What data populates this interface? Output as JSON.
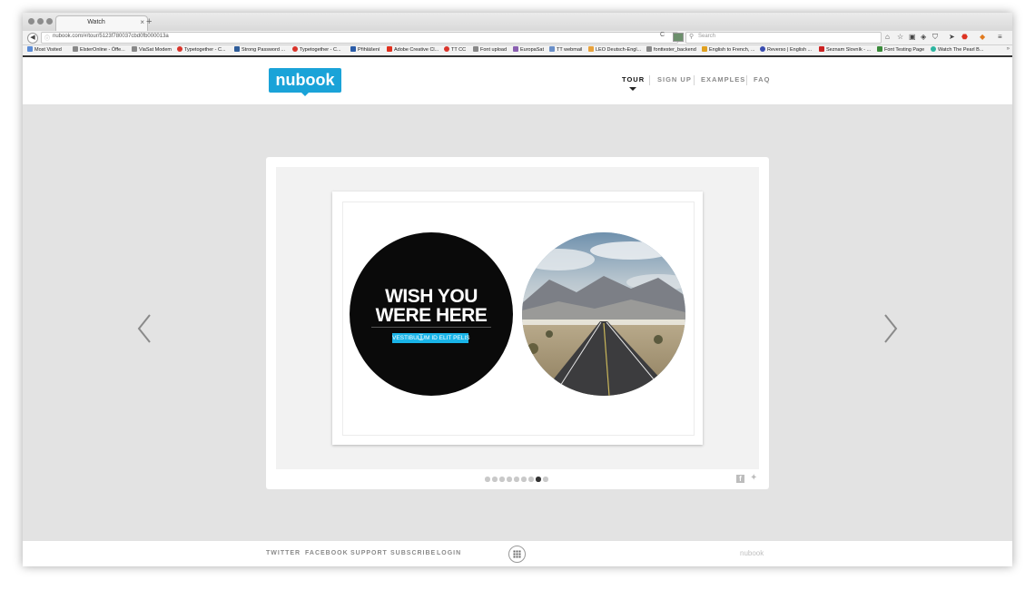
{
  "browser": {
    "tab_title": "Watch",
    "tab_close": "×",
    "new_tab": "+",
    "url": "nubook.com/#/tour/5123f780037cbd0fb000013a",
    "search_placeholder": "Search",
    "bookmarks": [
      {
        "label": "Most Visited",
        "color": "#5a8bd6"
      },
      {
        "label": "ElsterOnline - Öffe...",
        "color": "#888888"
      },
      {
        "label": "ViaSat Modem",
        "color": "#888888"
      },
      {
        "label": "Typetogether - C...",
        "color": "#d9342b"
      },
      {
        "label": "Strong Password ...",
        "color": "#2f5d9a"
      },
      {
        "label": "Typetogether - C...",
        "color": "#d9342b"
      },
      {
        "label": "Přihlášení",
        "color": "#2b5ca8"
      },
      {
        "label": "Adobe Creative Cl...",
        "color": "#e0301e"
      },
      {
        "label": "TT CC",
        "color": "#d9342b"
      },
      {
        "label": "Font upload",
        "color": "#888888"
      },
      {
        "label": "EuropaSat",
        "color": "#8a5fb0"
      },
      {
        "label": "TT webmail",
        "color": "#6a8fc8"
      },
      {
        "label": "LEO Deutsch-Engl...",
        "color": "#e8a23b"
      },
      {
        "label": "fonttester_backend",
        "color": "#888888"
      },
      {
        "label": "English to French, ...",
        "color": "#e0a020"
      },
      {
        "label": "Reverso | English ...",
        "color": "#3a4db0"
      },
      {
        "label": "Seznam Slovník - ...",
        "color": "#cc2222"
      },
      {
        "label": "Font Testing Page",
        "color": "#3a8a3a"
      },
      {
        "label": "Watch The Pearl B...",
        "color": "#2cb5a0"
      }
    ],
    "bookmarks_overflow": "»"
  },
  "header": {
    "logo": "nubook",
    "nav": [
      {
        "label": "TOUR",
        "active": true
      },
      {
        "label": "SIGN UP",
        "active": false
      },
      {
        "label": "EXAMPLES",
        "active": false
      },
      {
        "label": "FAQ",
        "active": false
      }
    ]
  },
  "slide": {
    "headline_line1": "WISH YOU",
    "headline_line2": "WERE HERE",
    "subline": "VESTIBULUM ID ELIT PELIS",
    "total_pages": 9,
    "current_page": 8
  },
  "footer": {
    "links": [
      "TWITTER",
      "FACEBOOK",
      "SUPPORT",
      "SUBSCRIBE",
      "LOGIN"
    ],
    "brand": "nubook"
  },
  "colors": {
    "accent": "#1aa3d8",
    "background": "#e3e3e3"
  }
}
